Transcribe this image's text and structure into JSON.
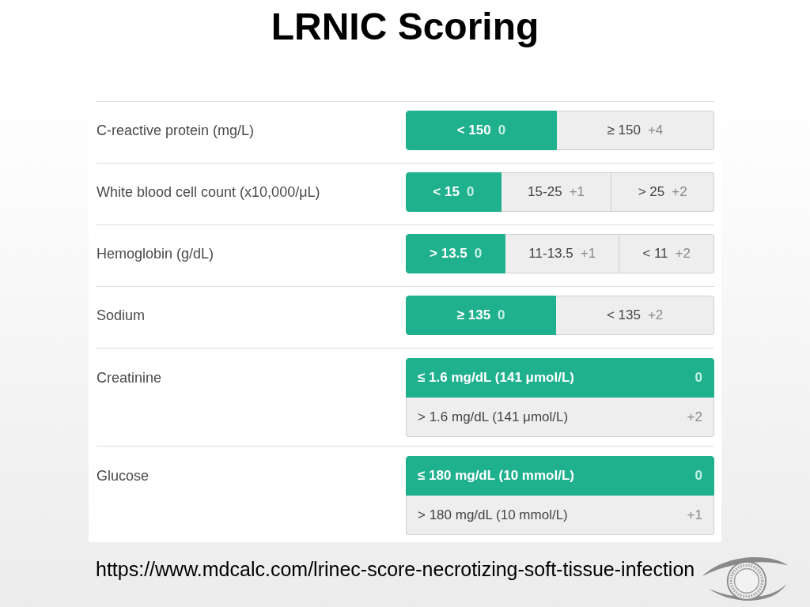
{
  "title": "LRNIC Scoring",
  "calculator": {
    "rows": [
      {
        "label": "C-reactive protein (mg/L)",
        "kind": "segmented",
        "options": [
          {
            "text": "< 150",
            "points": "0",
            "selected": true
          },
          {
            "text": "≥ 150",
            "points": "+4",
            "selected": false
          }
        ]
      },
      {
        "label": "White blood cell count (x10,000/μL)",
        "kind": "segmented",
        "options": [
          {
            "text": "< 15",
            "points": "0",
            "selected": true
          },
          {
            "text": "15-25",
            "points": "+1",
            "selected": false
          },
          {
            "text": "> 25",
            "points": "+2",
            "selected": false
          }
        ]
      },
      {
        "label": "Hemoglobin (g/dL)",
        "kind": "segmented",
        "options": [
          {
            "text": "> 13.5",
            "points": "0",
            "selected": true
          },
          {
            "text": "11-13.5",
            "points": "+1",
            "selected": false
          },
          {
            "text": "< 11",
            "points": "+2",
            "selected": false
          }
        ]
      },
      {
        "label": "Sodium",
        "kind": "segmented",
        "options": [
          {
            "text": "≥ 135",
            "points": "0",
            "selected": true
          },
          {
            "text": "< 135",
            "points": "+2",
            "selected": false
          }
        ]
      },
      {
        "label": "Creatinine",
        "kind": "stacked",
        "options": [
          {
            "text": "≤ 1.6 mg/dL (141 μmol/L)",
            "points": "0",
            "selected": true
          },
          {
            "text": "> 1.6 mg/dL (141 μmol/L)",
            "points": "+2",
            "selected": false
          }
        ]
      },
      {
        "label": "Glucose",
        "kind": "stacked",
        "options": [
          {
            "text": "≤ 180 mg/dL (10 mmol/L)",
            "points": "0",
            "selected": true
          },
          {
            "text": "> 180 mg/dL (10 mmol/L)",
            "points": "+1",
            "selected": false
          }
        ]
      }
    ]
  },
  "source_url": "https://www.mdcalc.com/lrinec-score-necrotizing-soft-tissue-infection"
}
